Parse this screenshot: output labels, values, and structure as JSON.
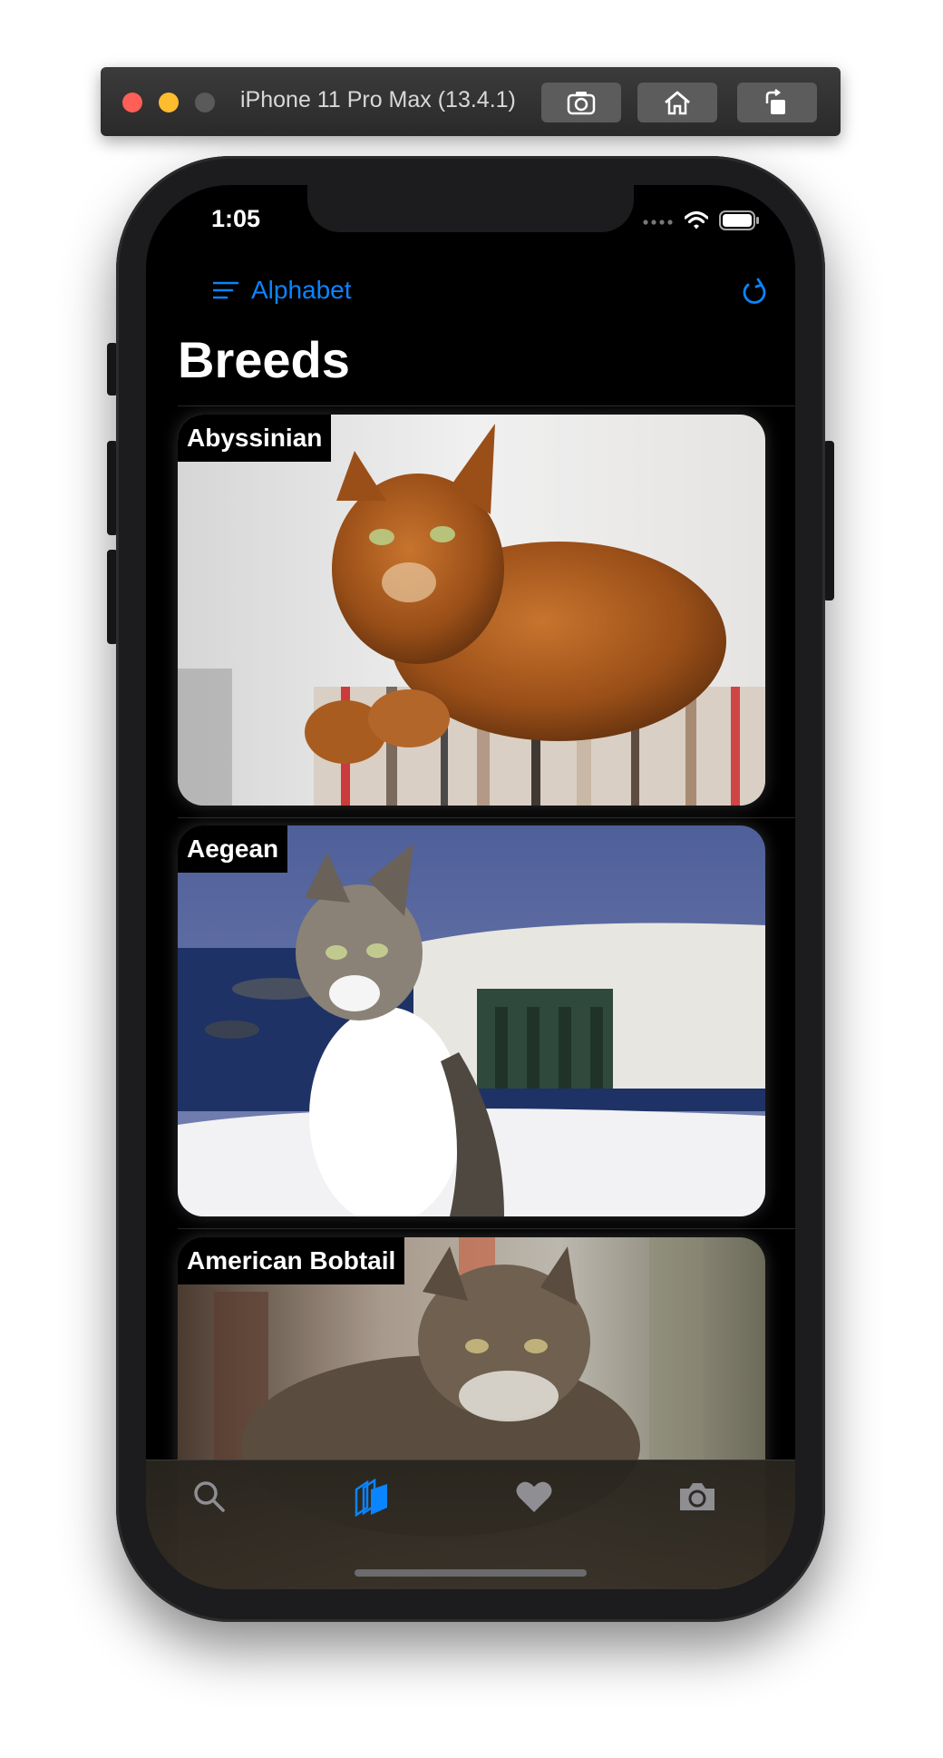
{
  "simulator": {
    "title": "iPhone 11 Pro Max (13.4.1)",
    "buttons": [
      "screenshot",
      "home",
      "rotate"
    ]
  },
  "status_bar": {
    "time": "1:05"
  },
  "nav": {
    "sort_label": "Alphabet",
    "title": "Breeds",
    "accent": "#0a84ff"
  },
  "breeds": [
    {
      "name": "Abyssinian"
    },
    {
      "name": "Aegean"
    },
    {
      "name": "American Bobtail"
    }
  ],
  "tabs": [
    {
      "icon": "search-icon",
      "selected": false
    },
    {
      "icon": "breeds-icon",
      "selected": true
    },
    {
      "icon": "heart-icon",
      "selected": false
    },
    {
      "icon": "camera-icon",
      "selected": false
    }
  ]
}
